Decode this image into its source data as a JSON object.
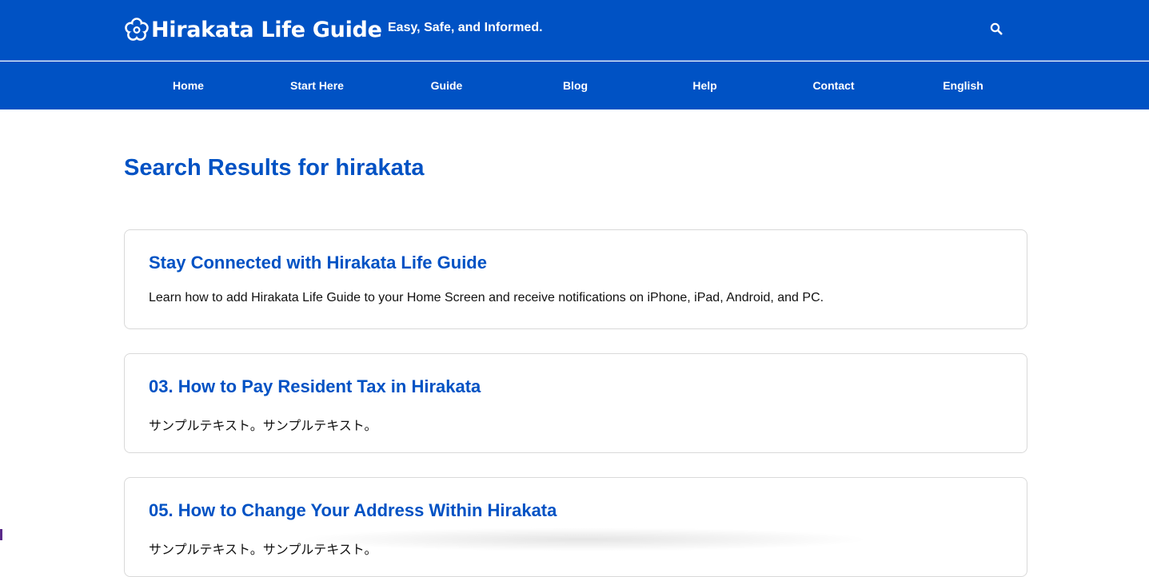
{
  "header": {
    "logo_text": "Hirakata Life Guide",
    "tagline": "Easy, Safe, and Informed.",
    "logo_icon": "flower-icon",
    "search_icon": "search-icon"
  },
  "nav": {
    "items": [
      {
        "label": "Home"
      },
      {
        "label": "Start Here"
      },
      {
        "label": "Guide"
      },
      {
        "label": "Blog"
      },
      {
        "label": "Help"
      },
      {
        "label": "Contact"
      },
      {
        "label": "English"
      }
    ]
  },
  "main": {
    "title": "Search Results for hirakata",
    "results": [
      {
        "title": "Stay Connected with Hirakata Life Guide",
        "excerpt": "Learn how to add Hirakata Life Guide to your Home Screen and receive notifications on iPhone, iPad, Android, and PC."
      },
      {
        "title": "03. How to Pay Resident Tax in Hirakata",
        "excerpt": "サンプルテキスト。サンプルテキスト。"
      },
      {
        "title": "05. How to Change Your Address Within Hirakata",
        "excerpt": "サンプルテキスト。サンプルテキスト。"
      }
    ]
  },
  "colors": {
    "brand": "#0052c4",
    "text": "#111111",
    "card_border": "#d9d9d9"
  }
}
